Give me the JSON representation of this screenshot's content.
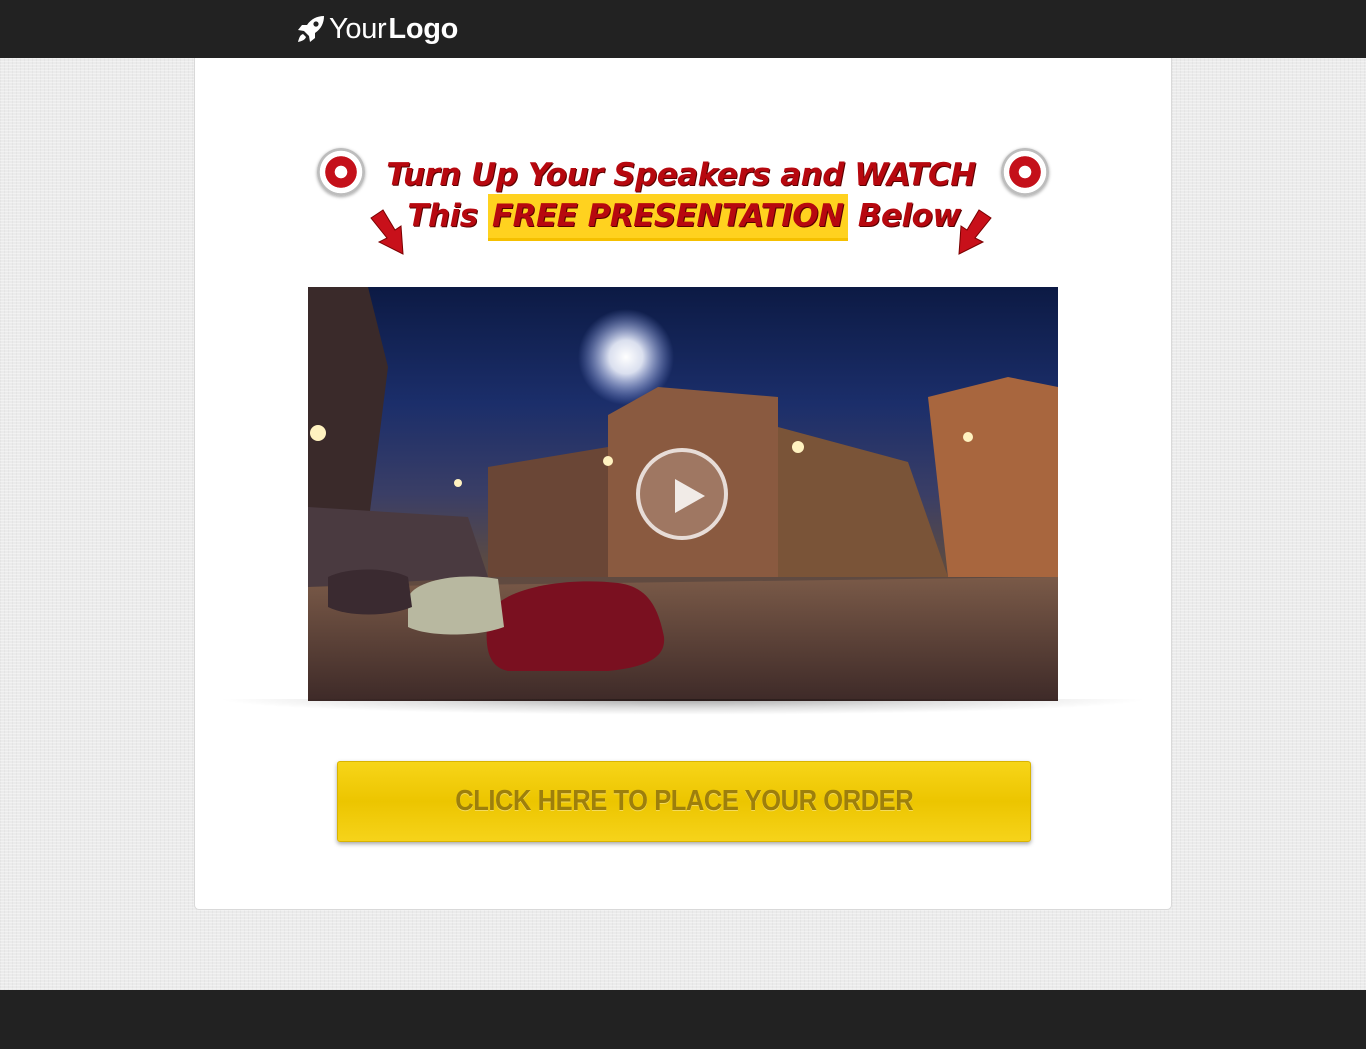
{
  "header": {
    "logo_text_regular": "Your",
    "logo_text_bold": "Logo",
    "logo_icon": "rocket-icon"
  },
  "headline": {
    "line1": "Turn Up Your Speakers and WATCH",
    "line2_before": "This",
    "line2_highlight": "FREE PRESENTATION",
    "line2_after": "Below",
    "icons": [
      "target-icon",
      "arrow-down-icon"
    ],
    "colors": {
      "text": "#b7080f",
      "highlight": "#ffd21f"
    }
  },
  "video": {
    "play_icon": "play-icon"
  },
  "cta": {
    "label": "CLICK HERE TO PLACE YOUR ORDER",
    "color": "#f2cd05"
  },
  "colors": {
    "bars": "#222222",
    "page_background": "#ebebeb",
    "card": "#ffffff"
  }
}
